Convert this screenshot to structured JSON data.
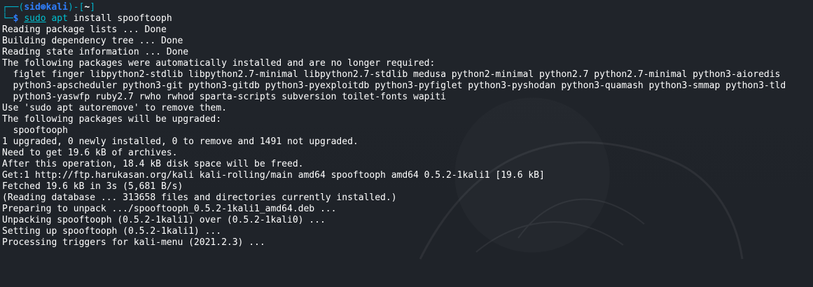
{
  "prompt": {
    "frame_top_left": "┌──(",
    "user": "sid",
    "host_icon": "⊛",
    "host": "kali",
    "frame_mid": ")-[",
    "dir": "~",
    "frame_end": "]",
    "frame_bottom": "└─",
    "dollar": "$"
  },
  "command": {
    "sudo": "sudo",
    "apt": "apt",
    "rest": " install spooftooph"
  },
  "output_lines": [
    "Reading package lists ... Done",
    "Building dependency tree ... Done",
    "Reading state information ... Done",
    "The following packages were automatically installed and are no longer required:",
    "  figlet finger libpython2-stdlib libpython2.7-minimal libpython2.7-stdlib medusa python2-minimal python2.7 python2.7-minimal python3-aioredis",
    "  python3-apscheduler python3-git python3-gitdb python3-pyexploitdb python3-pyfiglet python3-pyshodan python3-quamash python3-smmap python3-tld",
    "  python3-yaswfp ruby2.7 rwho rwhod sparta-scripts subversion toilet-fonts wapiti",
    "Use 'sudo apt autoremove' to remove them.",
    "The following packages will be upgraded:",
    "  spooftooph",
    "1 upgraded, 0 newly installed, 0 to remove and 1491 not upgraded.",
    "Need to get 19.6 kB of archives.",
    "After this operation, 18.4 kB disk space will be freed.",
    "Get:1 http://ftp.harukasan.org/kali kali-rolling/main amd64 spooftooph amd64 0.5.2-1kali1 [19.6 kB]",
    "Fetched 19.6 kB in 3s (5,681 B/s)",
    "(Reading database ... 313658 files and directories currently installed.)",
    "Preparing to unpack .../spooftooph_0.5.2-1kali1_amd64.deb ...",
    "Unpacking spooftooph (0.5.2-1kali1) over (0.5.2-1kali0) ...",
    "Setting up spooftooph (0.5.2-1kali1) ...",
    "Processing triggers for kali-menu (2021.2.3) ..."
  ],
  "colors": {
    "background": "#1f2329",
    "text": "#ffffff",
    "accent_blue": "#2f7fff",
    "accent_cyan": "#00c0d0"
  }
}
